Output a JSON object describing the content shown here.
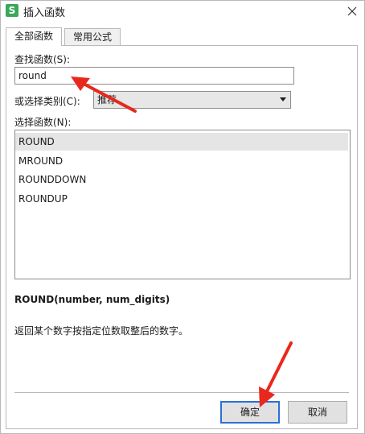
{
  "window": {
    "title": "插入函数",
    "app_icon_glyph": "S",
    "close_icon": "close-icon"
  },
  "tabs": [
    {
      "label": "全部函数",
      "active": true
    },
    {
      "label": "常用公式",
      "active": false
    }
  ],
  "search": {
    "label": "查找函数(S):",
    "value": "round"
  },
  "category": {
    "label": "或选择类别(C):",
    "selected": "推荐"
  },
  "function_list": {
    "label": "选择函数(N):",
    "items": [
      "ROUND",
      "MROUND",
      "ROUNDDOWN",
      "ROUNDUP"
    ],
    "selected_index": 0
  },
  "details": {
    "signature": "ROUND(number, num_digits)",
    "description": "返回某个数字按指定位数取整后的数字。"
  },
  "buttons": {
    "ok": "确定",
    "cancel": "取消"
  },
  "colors": {
    "app_icon": "#3aa858",
    "annotation_arrow": "#e8281c",
    "primary_border": "#2a6fd6",
    "selection": "#e5e5e5"
  }
}
